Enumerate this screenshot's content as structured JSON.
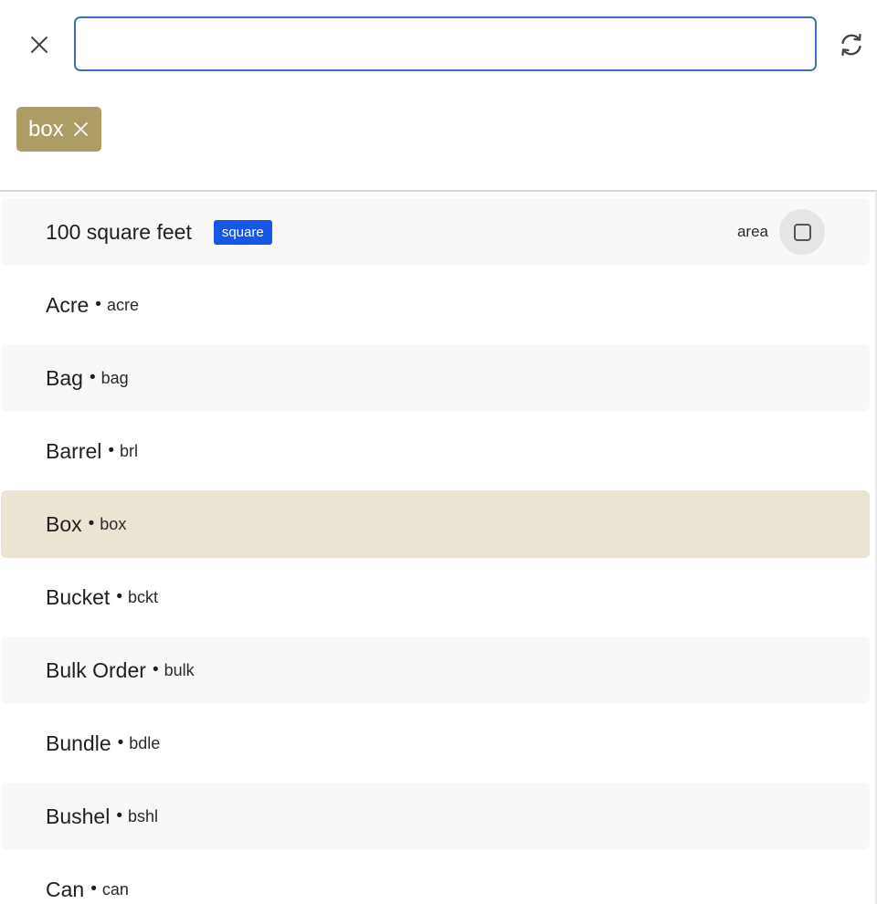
{
  "search": {
    "value": "",
    "clear_icon": "close-icon",
    "refresh_icon": "refresh-icon"
  },
  "filter_chips": [
    {
      "label": "box",
      "remove_icon": "close-icon"
    }
  ],
  "colors": {
    "input_border": "#3b6fc4",
    "chip_bg": "#ad9c63",
    "tag_bg": "#1756e6",
    "selected_row_bg": "#ebe4d3",
    "alt_row_bg": "#f8f8f8"
  },
  "units": [
    {
      "name": "100 square feet",
      "tag": "square",
      "category": "area",
      "checked": false
    },
    {
      "name": "Acre",
      "abbr": "acre"
    },
    {
      "name": "Bag",
      "abbr": "bag"
    },
    {
      "name": "Barrel",
      "abbr": "brl"
    },
    {
      "name": "Box",
      "abbr": "box",
      "selected": true
    },
    {
      "name": "Bucket",
      "abbr": "bckt"
    },
    {
      "name": "Bulk Order",
      "abbr": "bulk"
    },
    {
      "name": "Bundle",
      "abbr": "bdle"
    },
    {
      "name": "Bushel",
      "abbr": "bshl"
    },
    {
      "name": "Can",
      "abbr": "can"
    }
  ],
  "separator": "•"
}
